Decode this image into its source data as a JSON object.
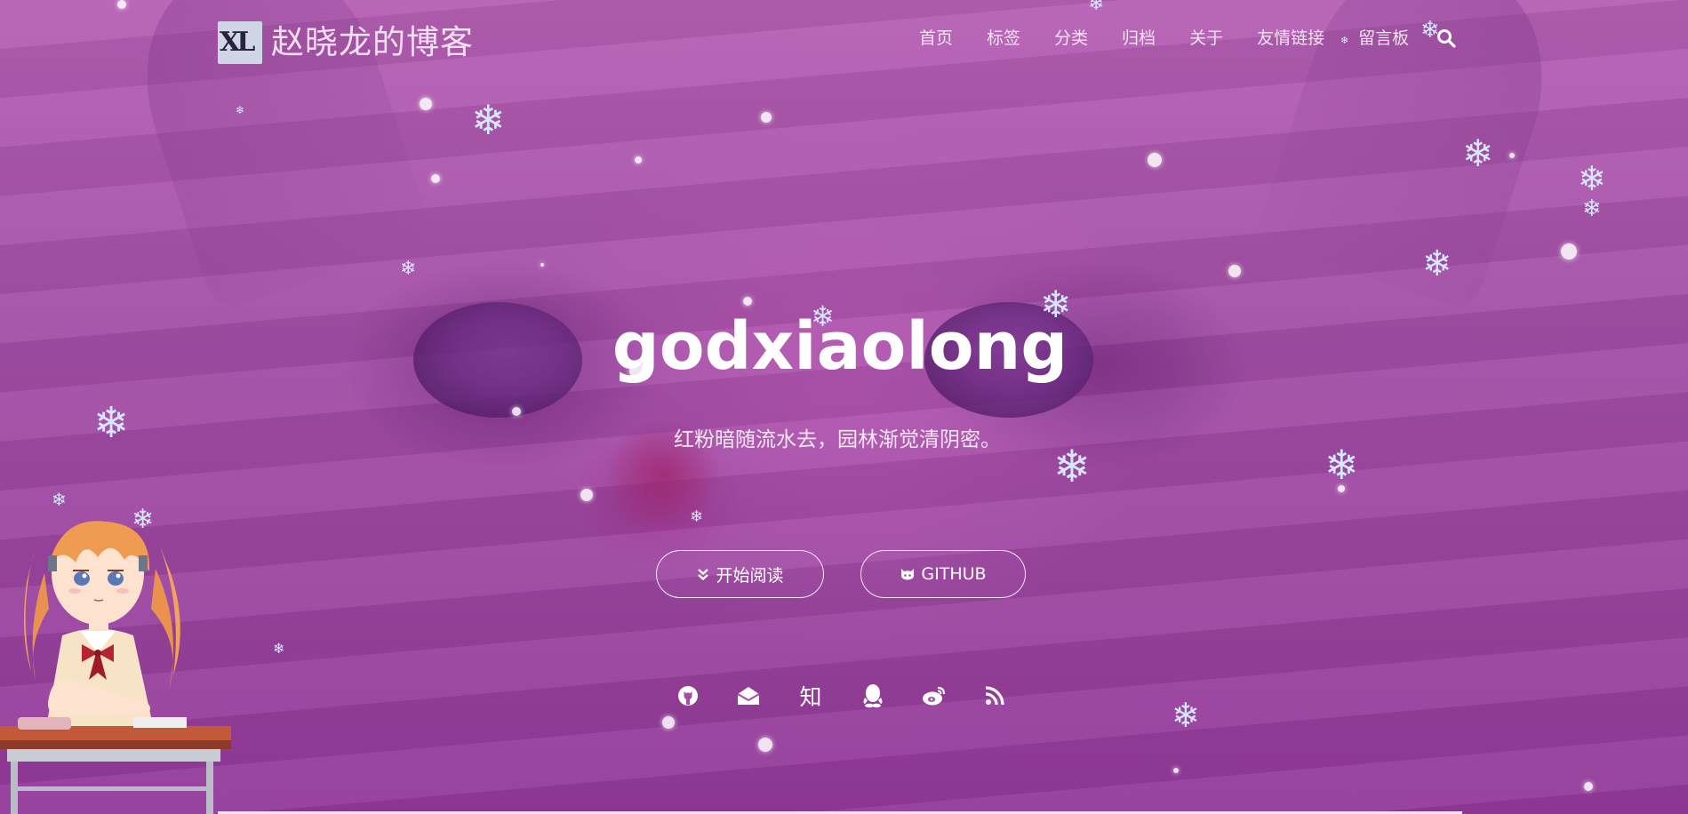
{
  "header": {
    "logo_text": "XL",
    "site_title": "赵晓龙的博客",
    "nav": [
      "首页",
      "标签",
      "分类",
      "归档",
      "关于",
      "友情链接",
      "留言板"
    ]
  },
  "hero": {
    "headline": "godxiaolong",
    "tagline": "红粉暗随流水去，园林渐觉清阴密。",
    "buttons": {
      "read": "开始阅读",
      "github": "GITHUB"
    },
    "social_icons": [
      "github-icon",
      "mail-icon",
      "zhihu-icon",
      "qq-icon",
      "weibo-icon",
      "rss-icon"
    ],
    "zhihu_glyph": "知"
  },
  "colors": {
    "overlay": "#b15bb0",
    "text": "#ffffff",
    "snowflake": "#d7e7ff"
  }
}
